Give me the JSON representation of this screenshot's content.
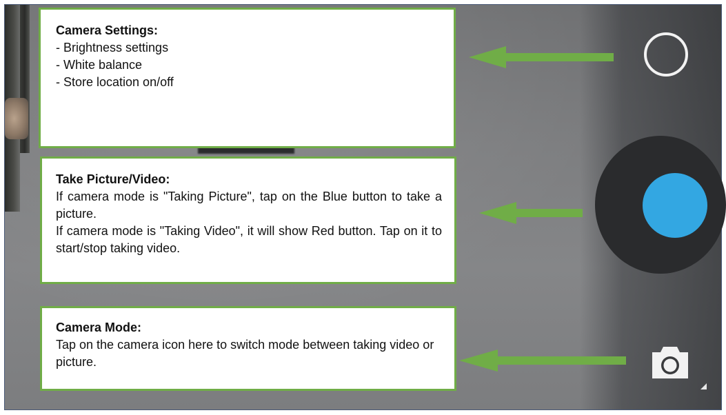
{
  "callouts": {
    "settings": {
      "title": "Camera Settings:",
      "items": [
        "- Brightness settings",
        "- White balance",
        "- Store location on/off"
      ]
    },
    "shutter": {
      "title": "Take Picture/Video:",
      "paragraphs": [
        "If camera mode is \"Taking Picture\", tap on the Blue button to take a picture.",
        "If camera mode is \"Taking Video\", it will show Red button. Tap on it to start/stop taking video."
      ]
    },
    "mode": {
      "title": "Camera Mode:",
      "text": "Tap on the camera icon here to switch mode between taking video or picture."
    }
  },
  "controls": {
    "settings_icon": "ring-icon",
    "shutter_icon": "shutter-button-icon",
    "mode_icon": "camera-icon"
  },
  "colors": {
    "callout_border": "#70ad47",
    "arrow": "#70ad47",
    "shutter_fill": "#33a7e2",
    "shutter_ring": "#2a2b2d",
    "icon_white": "#f2f2f2"
  }
}
